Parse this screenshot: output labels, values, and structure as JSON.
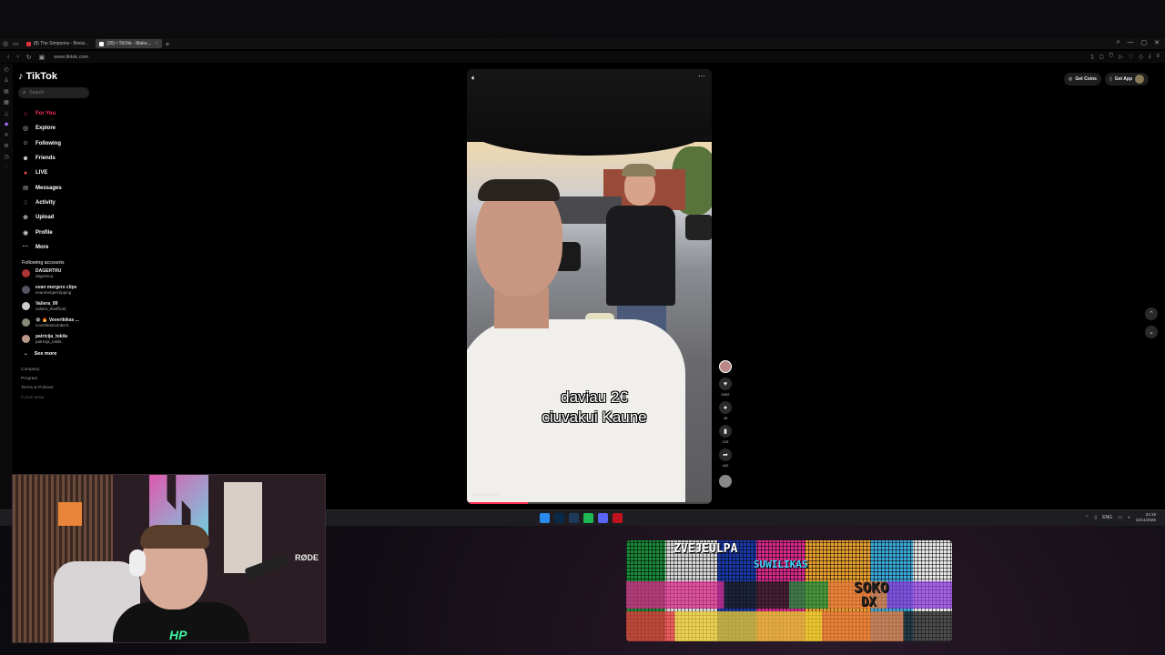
{
  "browser": {
    "tabs": [
      {
        "label": "(8) The Simpsons - Breisi...",
        "active": false,
        "color": "#e8303a"
      },
      {
        "label": "(30) • TikTok - Make...",
        "active": true,
        "color": "#ffffff"
      }
    ],
    "url": "www.tiktok.com"
  },
  "tiktok": {
    "logo": "TikTok",
    "search_placeholder": "Search",
    "menu": [
      {
        "label": "For You",
        "icon": "home-icon",
        "glyph": "⌂",
        "active": true
      },
      {
        "label": "Explore",
        "icon": "compass-icon",
        "glyph": "◎",
        "active": false
      },
      {
        "label": "Following",
        "icon": "user-check-icon",
        "glyph": "☺",
        "active": false
      },
      {
        "label": "Friends",
        "icon": "users-icon",
        "glyph": "☻",
        "active": false
      },
      {
        "label": "LIVE",
        "icon": "live-icon",
        "glyph": "●",
        "active": false
      },
      {
        "label": "Messages",
        "icon": "message-icon",
        "glyph": "✉",
        "active": false
      },
      {
        "label": "Activity",
        "icon": "bell-icon",
        "glyph": "♢",
        "active": false
      },
      {
        "label": "Upload",
        "icon": "upload-icon",
        "glyph": "⊕",
        "active": false
      },
      {
        "label": "Profile",
        "icon": "profile-icon",
        "glyph": "◉",
        "active": false
      },
      {
        "label": "More",
        "icon": "more-icon",
        "glyph": "···",
        "active": false
      }
    ],
    "following_title": "Following accounts",
    "accounts": [
      {
        "name": "DAGERTRU",
        "handle": "dagertruu"
      },
      {
        "name": "evan mergers clips",
        "handle": "evanmergerclipping"
      },
      {
        "name": "Valiera_99",
        "handle": "valiera_99official"
      },
      {
        "name": "😭 🔥 Voverikikas ...",
        "handle": "voverikasnumber1"
      },
      {
        "name": "patricija_tokila",
        "handle": "patricija_tokila"
      }
    ],
    "see_more": "See more",
    "footer": {
      "company": "Company",
      "program": "Program",
      "terms": "Terms & Policies",
      "copyright": "© 2025 TikTok"
    },
    "get_coins": "Get Coins",
    "get_app": "Get App",
    "video": {
      "caption_line1": "daviau 2€",
      "caption_line2": "ciuvakui Kaune",
      "handle": "mazva kk20lam",
      "progress_percent": 25
    },
    "actions": {
      "likes": "5492",
      "comments": "49",
      "saves": "123",
      "shares": "442"
    }
  },
  "taskbar": {
    "lang": "ENG",
    "time": "23:18",
    "date": "10/11/2025"
  },
  "webcam": {
    "mic_brand": "RØDE",
    "logo": "HP"
  },
  "banner": {
    "line1": "ZVEJEULPA",
    "line2": "SUWILIKAS",
    "line3": "SOKO",
    "line4": "DX"
  }
}
